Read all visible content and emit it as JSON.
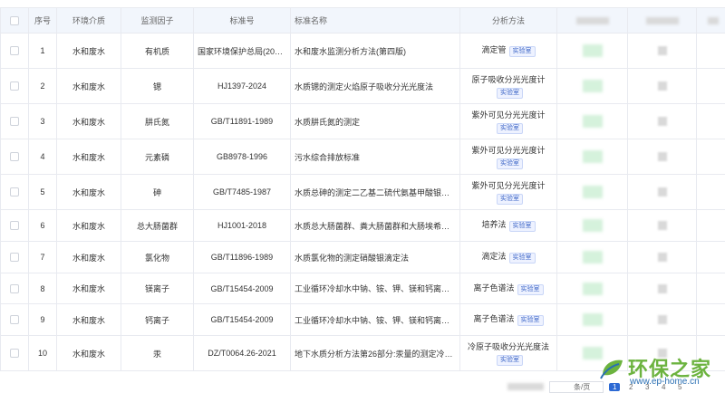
{
  "table": {
    "columns": [
      "序号",
      "环境介质",
      "监测因子",
      "标准号",
      "标准名称",
      "分析方法"
    ],
    "tag_label": "实验室",
    "rows": [
      {
        "no": "1",
        "medium": "水和废水",
        "factor": "有机质",
        "std_no": "国家环境保护总局(200…",
        "std_name": "水和废水监测分析方法(第四版)",
        "method": "滴定管",
        "tag": true
      },
      {
        "no": "2",
        "medium": "水和废水",
        "factor": "锶",
        "std_no": "HJ1397-2024",
        "std_name": "水质锶的测定火焰原子吸收分光光度法",
        "method": "原子吸收分光光度计",
        "tag": true
      },
      {
        "no": "3",
        "medium": "水和废水",
        "factor": "肼氏氮",
        "std_no": "GB/T11891-1989",
        "std_name": "水质肼氏氮的测定",
        "method": "紫外可见分光光度计",
        "tag": true
      },
      {
        "no": "4",
        "medium": "水和废水",
        "factor": "元素磷",
        "std_no": "GB8978-1996",
        "std_name": "污水综合排放标准",
        "method": "紫外可见分光光度计",
        "tag": true
      },
      {
        "no": "5",
        "medium": "水和废水",
        "factor": "砷",
        "std_no": "GB/T7485-1987",
        "std_name": "水质总砷的测定二乙基二硫代氨基甲酸银分光…",
        "method": "紫外可见分光光度计",
        "tag": true
      },
      {
        "no": "6",
        "medium": "水和废水",
        "factor": "总大肠菌群",
        "std_no": "HJ1001-2018",
        "std_name": "水质总大肠菌群、粪大肠菌群和大肠埃希氏菌…",
        "method": "培养法",
        "tag": true
      },
      {
        "no": "7",
        "medium": "水和废水",
        "factor": "氯化物",
        "std_no": "GB/T11896-1989",
        "std_name": "水质氯化物的测定硝酸银滴定法",
        "method": "滴定法",
        "tag": true
      },
      {
        "no": "8",
        "medium": "水和废水",
        "factor": "镁离子",
        "std_no": "GB/T15454-2009",
        "std_name": "工业循环冷却水中钠、铵、钾、镁和钙离子的测…",
        "method": "离子色谱法",
        "tag": true
      },
      {
        "no": "9",
        "medium": "水和废水",
        "factor": "钙离子",
        "std_no": "GB/T15454-2009",
        "std_name": "工业循环冷却水中钠、铵、钾、镁和钙离子的测…",
        "method": "离子色谱法",
        "tag": true
      },
      {
        "no": "10",
        "medium": "水和废水",
        "factor": "汞",
        "std_no": "DZ/T0064.26-2021",
        "std_name": "地下水质分析方法第26部分:汞量的测定冷原…",
        "method": "冷原子吸收分光光度法",
        "tag": true
      }
    ]
  },
  "pager": {
    "size_label": "条/页",
    "pages": [
      "1",
      "2",
      "3",
      "4",
      "5"
    ],
    "active": "1"
  },
  "watermark": {
    "name": "环保之家",
    "url": "www.ep-home.cn",
    "green": "#6cb33f",
    "blue": "#2a6fb3"
  },
  "colors": {
    "header_bg": "#f2f6fc",
    "tag_text": "#3e67c7",
    "active_page": "#2d6ad4"
  }
}
